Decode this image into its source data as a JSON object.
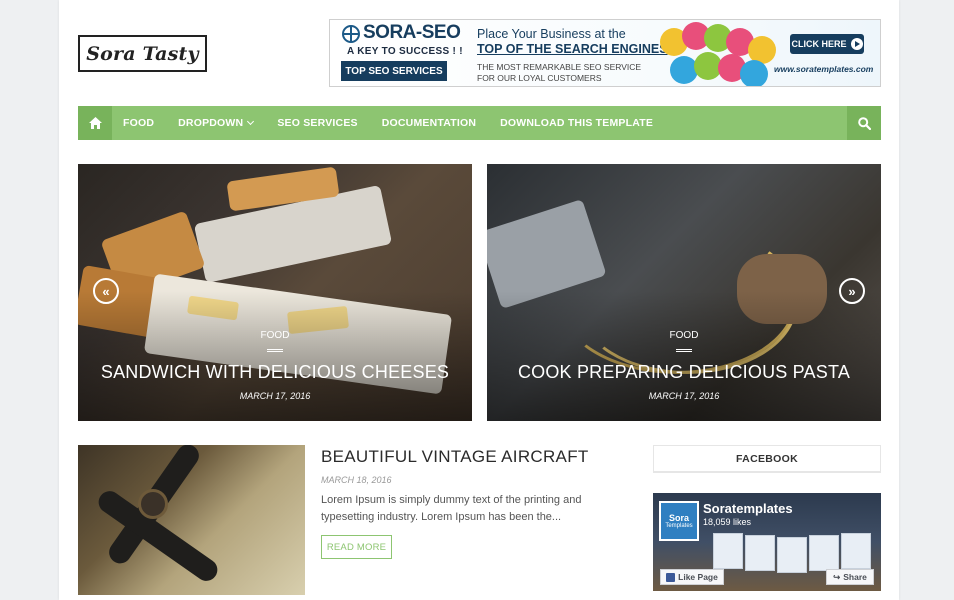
{
  "logo": {
    "text": "Sora Tasty"
  },
  "banner": {
    "brand": "SORA-SEO",
    "tagline": "A KEY TO SUCCESS ! !",
    "service": "TOP SEO SERVICES",
    "headline1": "Place Your Business at the",
    "headline2": "TOP OF THE SEARCH ENGINES",
    "subtext": "THE MOST REMARKABLE SEO SERVICE FOR OUR LOYAL CUSTOMERS",
    "cta": "CLICK HERE",
    "site": "www.soratemplates.com"
  },
  "nav": {
    "items": [
      {
        "label": "FOOD"
      },
      {
        "label": "DROPDOWN"
      },
      {
        "label": "SEO SERVICES"
      },
      {
        "label": "DOCUMENTATION"
      },
      {
        "label": "DOWNLOAD THIS TEMPLATE"
      }
    ],
    "accent": "#8dc571"
  },
  "slider": [
    {
      "category": "FOOD",
      "title": "SANDWICH WITH DELICIOUS CHEESES",
      "date": "MARCH 17, 2016"
    },
    {
      "category": "FOOD",
      "title": "COOK PREPARING DELICIOUS PASTA",
      "date": "MARCH 17, 2016"
    }
  ],
  "post": {
    "title": "BEAUTIFUL VINTAGE AIRCRAFT",
    "date": "MARCH 18, 2016",
    "excerpt": "Lorem Ipsum is simply dummy text of the printing and typesetting industry. Lorem Ipsum has been the...",
    "read_more": "READ MORE"
  },
  "sidebar": {
    "widget_title": "FACEBOOK",
    "facebook": {
      "page_name": "Soratemplates",
      "likes": "18,059 likes",
      "avatar_title": "Sora",
      "avatar_sub": "Templates",
      "like_label": "Like Page",
      "share_label": "Share"
    }
  }
}
